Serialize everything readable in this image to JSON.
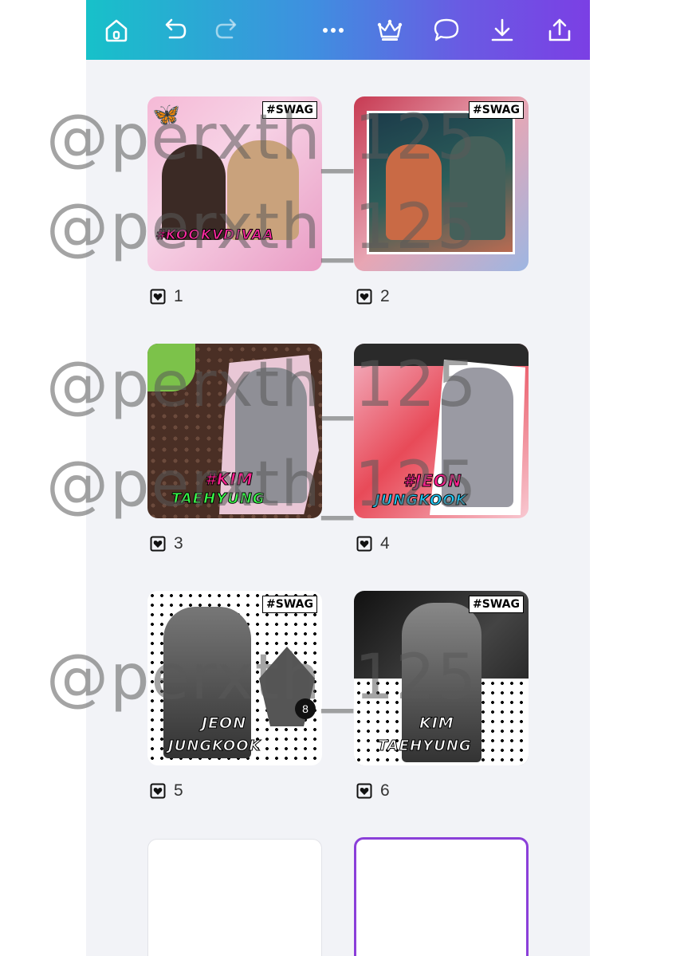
{
  "toolbar": {
    "icons": [
      "home-icon",
      "undo-icon",
      "redo-icon",
      "more-icon",
      "crown-icon",
      "comment-icon",
      "download-icon",
      "share-icon"
    ]
  },
  "pages": [
    {
      "number": "1",
      "tag_line1": "#KOOKVDIVAA",
      "tag_line2": "",
      "swag": "#SWAG"
    },
    {
      "number": "2",
      "tag_line1": "",
      "tag_line2": "",
      "swag": "#SWAG"
    },
    {
      "number": "3",
      "tag_line1": "#KIM",
      "tag_line2": "TAEHYUNG",
      "swag": ""
    },
    {
      "number": "4",
      "tag_line1": "#JEON",
      "tag_line2": "JUNGKOOK",
      "swag": ""
    },
    {
      "number": "5",
      "tag_line1": "JEON",
      "tag_line2": "JUNGKOOK",
      "swag": "#SWAG"
    },
    {
      "number": "6",
      "tag_line1": "KIM",
      "tag_line2": "TAEHYUNG",
      "swag": "#SWAG"
    }
  ],
  "watermark": "@perxth_125",
  "colors": {
    "accent": "#8b3fd9",
    "topbar_start": "#17c1c9",
    "topbar_end": "#7b3fe4"
  }
}
